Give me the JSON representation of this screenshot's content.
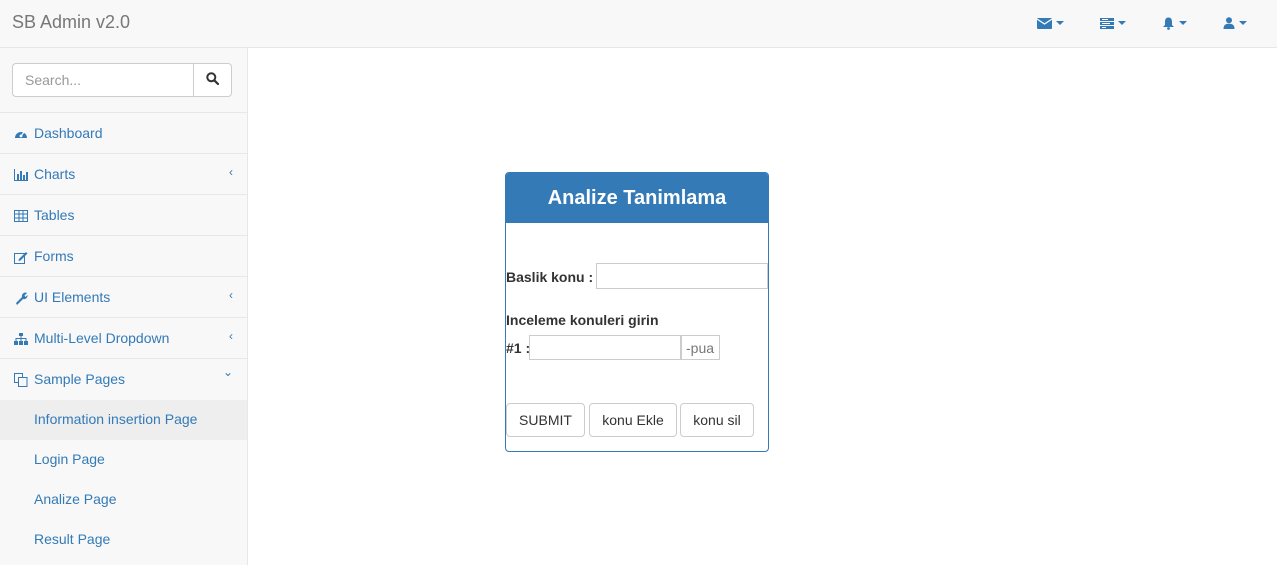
{
  "navbar": {
    "brand": "SB Admin v2.0",
    "icons": [
      "envelope-icon",
      "tasks-icon",
      "bell-icon",
      "user-icon"
    ]
  },
  "sidebar": {
    "search": {
      "placeholder": "Search...",
      "value": ""
    },
    "items": [
      {
        "label": "Dashboard",
        "icon": "dashboard-icon",
        "arrow": ""
      },
      {
        "label": "Charts",
        "icon": "bar-chart-icon",
        "arrow": "‹"
      },
      {
        "label": "Tables",
        "icon": "table-icon",
        "arrow": ""
      },
      {
        "label": "Forms",
        "icon": "edit-icon",
        "arrow": ""
      },
      {
        "label": "UI Elements",
        "icon": "wrench-icon",
        "arrow": "‹"
      },
      {
        "label": "Multi-Level Dropdown",
        "icon": "sitemap-icon",
        "arrow": "‹"
      },
      {
        "label": "Sample Pages",
        "icon": "files-icon",
        "arrow": "⌄"
      }
    ],
    "sub_items": [
      {
        "label": "Information insertion Page",
        "active": true
      },
      {
        "label": "Login Page",
        "active": false
      },
      {
        "label": "Analize Page",
        "active": false
      },
      {
        "label": "Result Page",
        "active": false
      }
    ]
  },
  "form": {
    "title": "Analize Tanimlama",
    "baslik_label": "Baslik konu :",
    "baslik_value": "",
    "inceleme_label": "Inceleme konuleri girin",
    "row1_label": "#1 :",
    "row1_value": "",
    "row1_points_placeholder": "-puan",
    "buttons": {
      "submit": "SUBMIT",
      "add": "konu Ekle",
      "delete": "konu sil"
    }
  },
  "colors": {
    "accent": "#337ab7",
    "navbar_bg": "#f8f8f8",
    "border": "#e7e7e7"
  }
}
